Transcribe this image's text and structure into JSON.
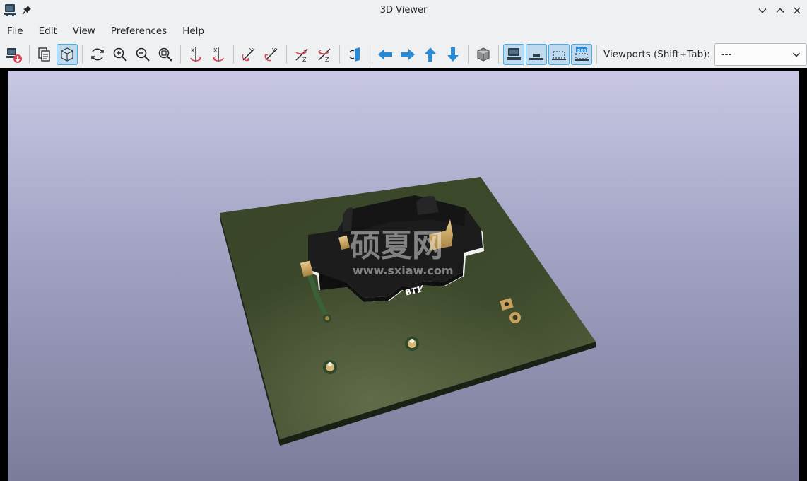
{
  "window": {
    "title": "3D Viewer"
  },
  "menubar": {
    "items": [
      "File",
      "Edit",
      "View",
      "Preferences",
      "Help"
    ]
  },
  "toolbar": {
    "viewports_label": "Viewports (Shift+Tab):",
    "viewports_value": "---"
  },
  "viewer": {
    "silkscreen_ref": "BT1",
    "watermark_cn": "硕夏网",
    "watermark_url": "www.sxiaw.com"
  },
  "colors": {
    "accent": "#3daee9",
    "arrow_blue": "#2a8ad4",
    "pcb_green": "#3d4a2c",
    "holder_black": "#1c1c1c",
    "pad_gold": "#c8a25a"
  }
}
